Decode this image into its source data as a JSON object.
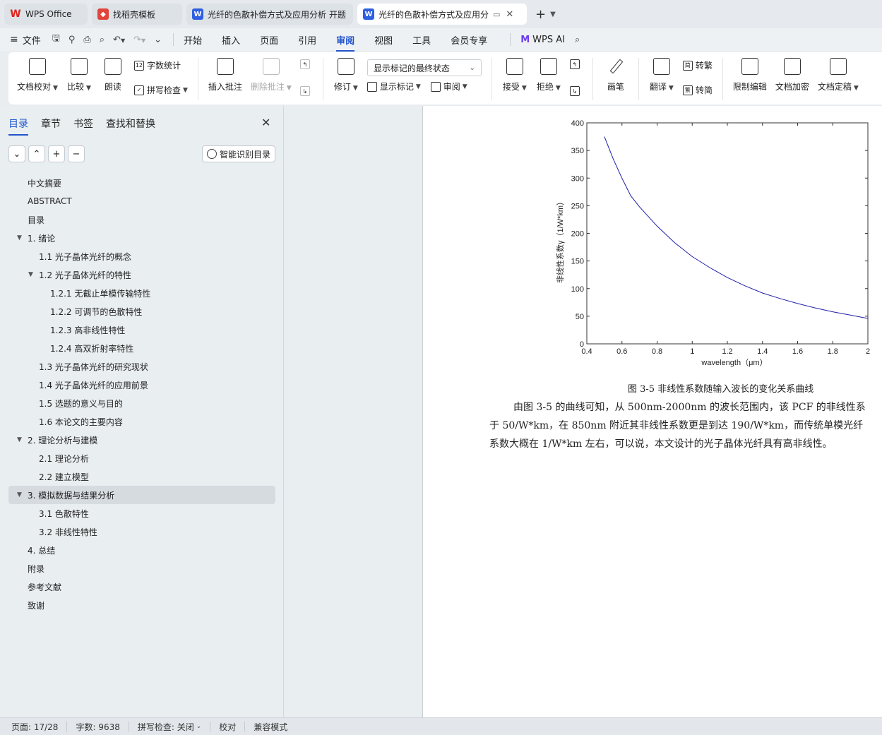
{
  "tabs": [
    {
      "label": "WPS Office",
      "icon": "wps-logo-icon"
    },
    {
      "label": "找稻壳模板",
      "icon": "docer-icon"
    },
    {
      "label": "光纤的色散补偿方式及应用分析 开题",
      "icon": "word-doc-icon"
    },
    {
      "label": "光纤的色散补偿方式及应用分",
      "icon": "word-doc-icon"
    }
  ],
  "menubar": {
    "file": "文件",
    "items": [
      "开始",
      "插入",
      "页面",
      "引用",
      "审阅",
      "视图",
      "工具",
      "会员专享"
    ],
    "active": "审阅",
    "ai": "WPS AI"
  },
  "ribbon": {
    "proofread": "文档校对",
    "compare": "比较",
    "read_aloud": "朗读",
    "word_count": "字数统计",
    "spell_check": "拼写检查",
    "insert_comment": "插入批注",
    "delete_comment": "删除批注",
    "track_changes": "修订",
    "markup_state": "显示标记的最终状态",
    "show_markup": "显示标记",
    "review": "审阅",
    "accept": "接受",
    "reject": "拒绝",
    "ink": "画笔",
    "translate": "翻译",
    "to_traditional": "转繁",
    "to_simplified": "转简",
    "restrict_edit": "限制编辑",
    "encrypt": "文档加密",
    "finalize": "文档定稿"
  },
  "nav": {
    "tabs": [
      "目录",
      "章节",
      "书签",
      "查找和替换"
    ],
    "smart_toc": "智能识别目录",
    "toc": [
      {
        "text": "中文摘要",
        "level": 1,
        "arrow": false
      },
      {
        "text": "ABSTRACT",
        "level": 1,
        "arrow": false
      },
      {
        "text": "目录",
        "level": 1,
        "arrow": false
      },
      {
        "text": "1. 绪论",
        "level": 1,
        "arrow": true
      },
      {
        "text": "1.1 光子晶体光纤的概念",
        "level": 2,
        "arrow": false
      },
      {
        "text": "1.2 光子晶体光纤的特性",
        "level": 2,
        "arrow": true
      },
      {
        "text": "1.2.1 无截止单模传输特性",
        "level": 3,
        "arrow": false
      },
      {
        "text": "1.2.2 可调节的色散特性",
        "level": 3,
        "arrow": false
      },
      {
        "text": "1.2.3 高非线性特性",
        "level": 3,
        "arrow": false
      },
      {
        "text": "1.2.4 高双折射率特性",
        "level": 3,
        "arrow": false
      },
      {
        "text": "1.3 光子晶体光纤的研究现状",
        "level": 2,
        "arrow": false
      },
      {
        "text": "1.4 光子晶体光纤的应用前景",
        "level": 2,
        "arrow": false
      },
      {
        "text": "1.5 选题的意义与目的",
        "level": 2,
        "arrow": false
      },
      {
        "text": "1.6 本论文的主要内容",
        "level": 2,
        "arrow": false
      },
      {
        "text": "2. 理论分析与建模",
        "level": 1,
        "arrow": true
      },
      {
        "text": "2.1 理论分析",
        "level": 2,
        "arrow": false
      },
      {
        "text": "2.2 建立模型",
        "level": 2,
        "arrow": false
      },
      {
        "text": "3. 模拟数据与结果分析",
        "level": 1,
        "arrow": true,
        "selected": true
      },
      {
        "text": "3.1 色散特性",
        "level": 2,
        "arrow": false
      },
      {
        "text": "3.2 非线性特性",
        "level": 2,
        "arrow": false
      },
      {
        "text": "4. 总结",
        "level": 1,
        "arrow": false
      },
      {
        "text": "附录",
        "level": 1,
        "arrow": false
      },
      {
        "text": "参考文献",
        "level": 1,
        "arrow": false
      },
      {
        "text": "致谢",
        "level": 1,
        "arrow": false
      }
    ]
  },
  "document": {
    "caption": "图 3-5 非线性系数随输入波长的变化关系曲线",
    "paragraph_lines": [
      "由图 3-5 的曲线可知，从 500nm-2000nm 的波长范围内，该 PCF 的非线性系",
      "于 50/W*km，在 850nm 附近其非线性系数更是到达 190/W*km，而传统单模光纤",
      "系数大概在 1/W*km 左右，可以说，本文设计的光子晶体光纤具有高非线性。"
    ]
  },
  "chart_data": {
    "type": "line",
    "xlabel": "wavelength（μm）",
    "ylabel": "非线性系数γ（1/W*km）",
    "xlim": [
      0.4,
      2.0
    ],
    "ylim": [
      0,
      400
    ],
    "xticks": [
      "0.4",
      "0.6",
      "0.8",
      "1",
      "1.2",
      "1.4",
      "1.6",
      "1.8",
      "2"
    ],
    "yticks": [
      "0",
      "50",
      "100",
      "150",
      "200",
      "250",
      "300",
      "350",
      "400"
    ],
    "line_color": "#1f1fa8",
    "series": [
      {
        "x": [
          0.5,
          0.55,
          0.6,
          0.65,
          0.7,
          0.8,
          0.9,
          1.0,
          1.1,
          1.2,
          1.3,
          1.4,
          1.5,
          1.6,
          1.7,
          1.8,
          1.9,
          2.0
        ],
        "y": [
          375,
          335,
          300,
          268,
          248,
          213,
          183,
          158,
          138,
          120,
          105,
          92,
          82,
          73,
          65,
          58,
          52,
          46
        ]
      }
    ]
  },
  "status": {
    "page": "页面: 17/28",
    "words": "字数: 9638",
    "spell": "拼写检查: 关闭",
    "proof": "校对",
    "compat": "兼容模式"
  }
}
